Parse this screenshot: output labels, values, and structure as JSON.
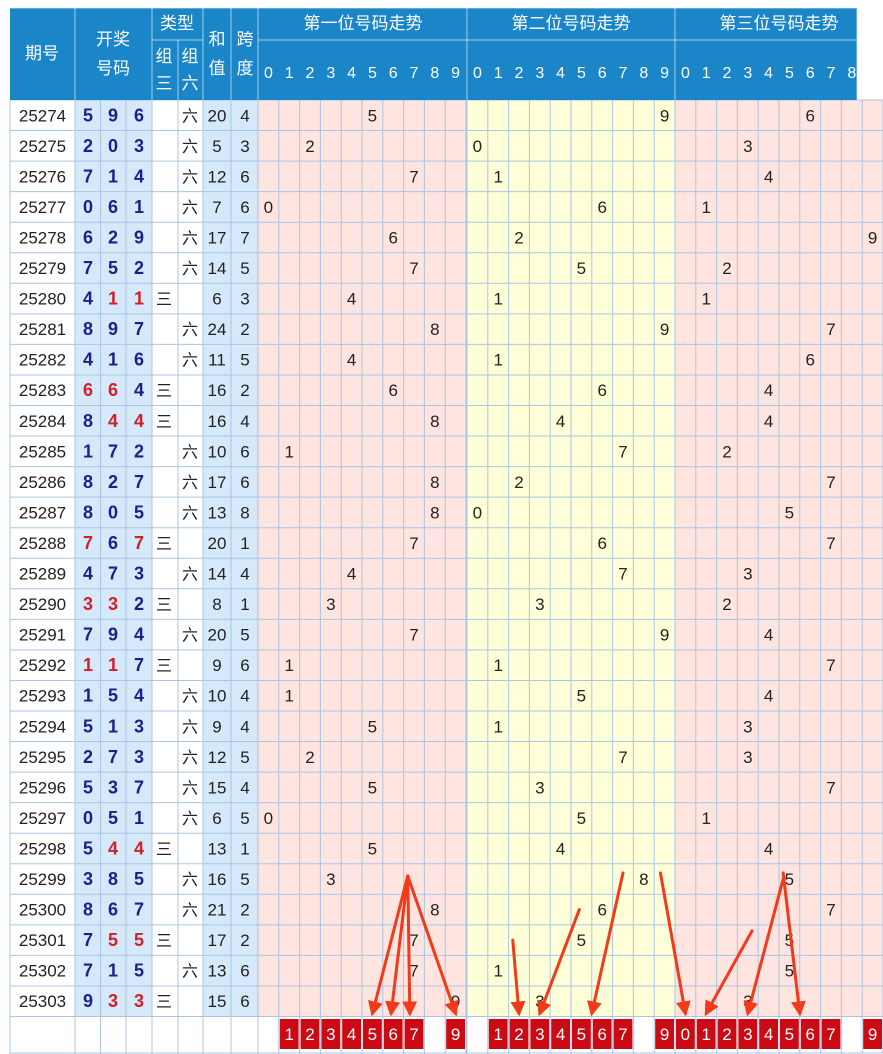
{
  "header": {
    "period": "期号",
    "draw_line1": "开奖",
    "draw_line2": "号码",
    "type": "类型",
    "group3_line1": "组",
    "group3_line2": "三",
    "group6_line1": "组",
    "group6_line2": "六",
    "sum_line1": "和",
    "sum_line2": "值",
    "span_line1": "跨",
    "span_line2": "度",
    "pos1": "第一位号码走势",
    "pos2": "第二位号码走势",
    "pos3": "第三位号码走势",
    "digits": [
      "0",
      "1",
      "2",
      "3",
      "4",
      "5",
      "6",
      "7",
      "8",
      "9"
    ]
  },
  "colors": {
    "header_bg": "#1a86c8",
    "header_text": "#ffffff",
    "grid_line": "#a9c6e3",
    "period_bg": "#ffffff",
    "draw_bg": "#d6e9fa",
    "type_bg": "#ffffff",
    "sum_bg": "#d6e9fa",
    "span_bg": "#d6e9fa",
    "pos1_bg": "#ffe4df",
    "pos2_bg": "#ffffd8",
    "pos3_bg": "#ffe4df",
    "digit_normal": "#17238a",
    "digit_repeat": "#d0202a",
    "marker_bg": "#cc0a14",
    "marker_text": "#ffffff",
    "arrow": "#f23a1a"
  },
  "rows": [
    {
      "period": "25274",
      "num": [
        "5",
        "9",
        "6"
      ],
      "g3": "",
      "g6": "六",
      "sum": "20",
      "span": "4"
    },
    {
      "period": "25275",
      "num": [
        "2",
        "0",
        "3"
      ],
      "g3": "",
      "g6": "六",
      "sum": "5",
      "span": "3"
    },
    {
      "period": "25276",
      "num": [
        "7",
        "1",
        "4"
      ],
      "g3": "",
      "g6": "六",
      "sum": "12",
      "span": "6"
    },
    {
      "period": "25277",
      "num": [
        "0",
        "6",
        "1"
      ],
      "g3": "",
      "g6": "六",
      "sum": "7",
      "span": "6"
    },
    {
      "period": "25278",
      "num": [
        "6",
        "2",
        "9"
      ],
      "g3": "",
      "g6": "六",
      "sum": "17",
      "span": "7"
    },
    {
      "period": "25279",
      "num": [
        "7",
        "5",
        "2"
      ],
      "g3": "",
      "g6": "六",
      "sum": "14",
      "span": "5"
    },
    {
      "period": "25280",
      "num": [
        "4",
        "1",
        "1"
      ],
      "g3": "三",
      "g6": "",
      "sum": "6",
      "span": "3"
    },
    {
      "period": "25281",
      "num": [
        "8",
        "9",
        "7"
      ],
      "g3": "",
      "g6": "六",
      "sum": "24",
      "span": "2"
    },
    {
      "period": "25282",
      "num": [
        "4",
        "1",
        "6"
      ],
      "g3": "",
      "g6": "六",
      "sum": "11",
      "span": "5"
    },
    {
      "period": "25283",
      "num": [
        "6",
        "6",
        "4"
      ],
      "g3": "三",
      "g6": "",
      "sum": "16",
      "span": "2"
    },
    {
      "period": "25284",
      "num": [
        "8",
        "4",
        "4"
      ],
      "g3": "三",
      "g6": "",
      "sum": "16",
      "span": "4"
    },
    {
      "period": "25285",
      "num": [
        "1",
        "7",
        "2"
      ],
      "g3": "",
      "g6": "六",
      "sum": "10",
      "span": "6"
    },
    {
      "period": "25286",
      "num": [
        "8",
        "2",
        "7"
      ],
      "g3": "",
      "g6": "六",
      "sum": "17",
      "span": "6"
    },
    {
      "period": "25287",
      "num": [
        "8",
        "0",
        "5"
      ],
      "g3": "",
      "g6": "六",
      "sum": "13",
      "span": "8"
    },
    {
      "period": "25288",
      "num": [
        "7",
        "6",
        "7"
      ],
      "g3": "三",
      "g6": "",
      "sum": "20",
      "span": "1"
    },
    {
      "period": "25289",
      "num": [
        "4",
        "7",
        "3"
      ],
      "g3": "",
      "g6": "六",
      "sum": "14",
      "span": "4"
    },
    {
      "period": "25290",
      "num": [
        "3",
        "3",
        "2"
      ],
      "g3": "三",
      "g6": "",
      "sum": "8",
      "span": "1"
    },
    {
      "period": "25291",
      "num": [
        "7",
        "9",
        "4"
      ],
      "g3": "",
      "g6": "六",
      "sum": "20",
      "span": "5"
    },
    {
      "period": "25292",
      "num": [
        "1",
        "1",
        "7"
      ],
      "g3": "三",
      "g6": "",
      "sum": "9",
      "span": "6"
    },
    {
      "period": "25293",
      "num": [
        "1",
        "5",
        "4"
      ],
      "g3": "",
      "g6": "六",
      "sum": "10",
      "span": "4"
    },
    {
      "period": "25294",
      "num": [
        "5",
        "1",
        "3"
      ],
      "g3": "",
      "g6": "六",
      "sum": "9",
      "span": "4"
    },
    {
      "period": "25295",
      "num": [
        "2",
        "7",
        "3"
      ],
      "g3": "",
      "g6": "六",
      "sum": "12",
      "span": "5"
    },
    {
      "period": "25296",
      "num": [
        "5",
        "3",
        "7"
      ],
      "g3": "",
      "g6": "六",
      "sum": "15",
      "span": "4"
    },
    {
      "period": "25297",
      "num": [
        "0",
        "5",
        "1"
      ],
      "g3": "",
      "g6": "六",
      "sum": "6",
      "span": "5"
    },
    {
      "period": "25298",
      "num": [
        "5",
        "4",
        "4"
      ],
      "g3": "三",
      "g6": "",
      "sum": "13",
      "span": "1"
    },
    {
      "period": "25299",
      "num": [
        "3",
        "8",
        "5"
      ],
      "g3": "",
      "g6": "六",
      "sum": "16",
      "span": "5"
    },
    {
      "period": "25300",
      "num": [
        "8",
        "6",
        "7"
      ],
      "g3": "",
      "g6": "六",
      "sum": "21",
      "span": "2"
    },
    {
      "period": "25301",
      "num": [
        "7",
        "5",
        "5"
      ],
      "g3": "三",
      "g6": "",
      "sum": "17",
      "span": "2"
    },
    {
      "period": "25302",
      "num": [
        "7",
        "1",
        "5"
      ],
      "g3": "",
      "g6": "六",
      "sum": "13",
      "span": "6"
    },
    {
      "period": "25303",
      "num": [
        "9",
        "3",
        "3"
      ],
      "g3": "三",
      "g6": "",
      "sum": "15",
      "span": "6"
    }
  ],
  "markers": {
    "pos1": [
      "1",
      "2",
      "3",
      "4",
      "5",
      "6",
      "7",
      "9"
    ],
    "pos2": [
      "1",
      "2",
      "3",
      "4",
      "5",
      "6",
      "7",
      "9"
    ],
    "pos3": [
      "0",
      "1",
      "2",
      "3",
      "4",
      "5",
      "6",
      "7",
      "9"
    ]
  },
  "arrows": [
    {
      "from_section": "pos1",
      "from_digit": 6.7,
      "from_row": 25.4,
      "to_section": "pos1",
      "to_digit": 5,
      "to_row": 29.9
    },
    {
      "from_section": "pos1",
      "from_digit": 6.7,
      "from_row": 25.4,
      "to_section": "pos1",
      "to_digit": 5.9,
      "to_row": 29.9
    },
    {
      "from_section": "pos1",
      "from_digit": 6.7,
      "from_row": 25.4,
      "to_section": "pos1",
      "to_digit": 6.8,
      "to_row": 29.9
    },
    {
      "from_section": "pos1",
      "from_digit": 6.7,
      "from_row": 25.4,
      "to_section": "pos1",
      "to_digit": 9,
      "to_row": 29.9
    },
    {
      "from_section": "pos2",
      "from_digit": 1.7,
      "from_row": 27.5,
      "to_section": "pos2",
      "to_digit": 2,
      "to_row": 29.9
    },
    {
      "from_section": "pos2",
      "from_digit": 4.9,
      "from_row": 26.5,
      "to_section": "pos2",
      "to_digit": 3,
      "to_row": 29.9
    },
    {
      "from_section": "pos2",
      "from_digit": 7,
      "from_row": 25.3,
      "to_section": "pos2",
      "to_digit": 5.5,
      "to_row": 29.9
    },
    {
      "from_section": "pos2",
      "from_digit": 8.8,
      "from_row": 25.3,
      "to_section": "pos3",
      "to_digit": 0,
      "to_row": 29.9
    },
    {
      "from_section": "pos3",
      "from_digit": 3.2,
      "from_row": 27.2,
      "to_section": "pos3",
      "to_digit": 1,
      "to_row": 29.9
    },
    {
      "from_section": "pos3",
      "from_digit": 4.7,
      "from_row": 25.5,
      "to_section": "pos3",
      "to_digit": 3,
      "to_row": 29.9
    },
    {
      "from_section": "pos3",
      "from_digit": 4.7,
      "from_row": 25.3,
      "to_section": "pos3",
      "to_digit": 5.5,
      "to_row": 29.9
    }
  ]
}
